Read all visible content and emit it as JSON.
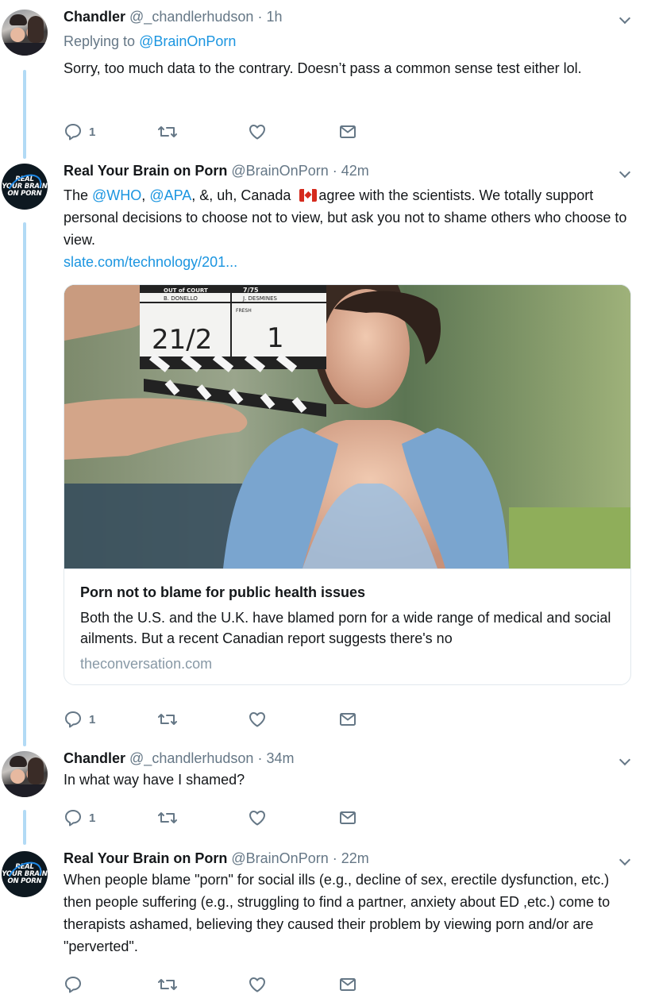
{
  "tweets": [
    {
      "name": "Chandler",
      "handle": "@_chandlerhudson",
      "time": "1h",
      "reply_prefix": "Replying to",
      "reply_handle": "@BrainOnPorn",
      "text": "Sorry, too much data to the contrary. Doesn’t pass a common sense test either lol.",
      "reply_count": "1"
    },
    {
      "name": "Real Your Brain on Porn",
      "handle": "@BrainOnPorn",
      "time": "42m",
      "text_parts": {
        "a": "The ",
        "m1": "@WHO",
        "b": ", ",
        "m2": "@APA",
        "c": ", &, uh, Canada ",
        "d": "agree with the scientists. We totally support personal decisions to choose not to view, but ask you not to shame others who choose to view.",
        "url": "slate.com/technology/201..."
      },
      "reply_count": "1",
      "card": {
        "title": "Porn not to blame for public health issues",
        "description": "Both the U.S. and the U.K. have blamed porn for a wide range of medical and social ailments. But a recent Canadian report suggests there's no",
        "domain": "theconversation.com",
        "slate_text": {
          "row1a": "OUT of COURT",
          "row1b": "7/75",
          "row2a": "B. DONELLO",
          "row2b": "J. DESMINES",
          "row3": "FRESH",
          "scene": "21/2",
          "take": "1"
        }
      }
    },
    {
      "name": "Chandler",
      "handle": "@_chandlerhudson",
      "time": "34m",
      "text": "In what way have I shamed?",
      "reply_count": "1"
    },
    {
      "name": "Real Your Brain on Porn",
      "handle": "@BrainOnPorn",
      "time": "22m",
      "text": "When people blame \"porn\" for social ills (e.g., decline of sex, erectile dysfunction, etc.) then people suffering (e.g., struggling to find a partner, anxiety about ED ,etc.) come to therapists ashamed, believing they caused their problem by viewing porn and/or are \"perverted\"."
    }
  ],
  "separator": "·",
  "logo_lines": [
    "REAL",
    "YOUR BRAIN",
    "ON PORN"
  ],
  "icons": {
    "reply": "reply-icon",
    "retweet": "retweet-icon",
    "like": "heart-icon",
    "dm": "envelope-icon",
    "menu": "chevron-down-icon"
  },
  "colors": {
    "link": "#1b95e0",
    "secondary": "#657786",
    "thread_line": "#b2daf5"
  }
}
